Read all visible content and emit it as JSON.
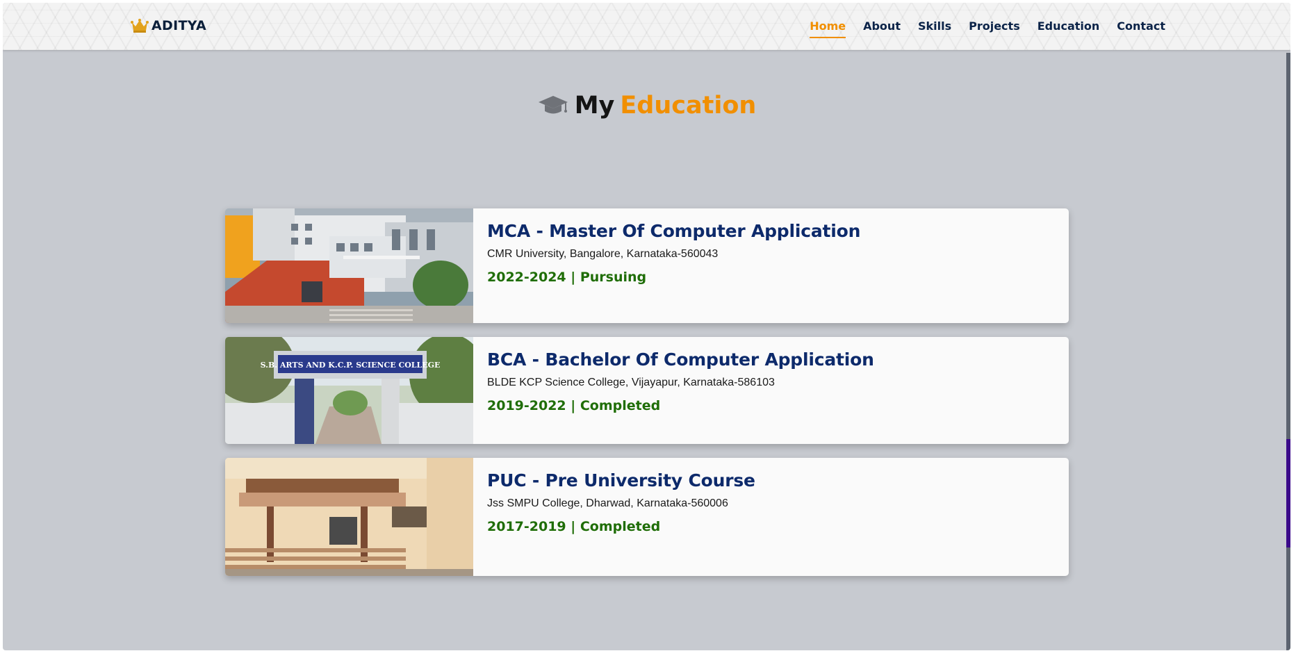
{
  "header": {
    "brand_name": "ADITYA",
    "brand_icon": "crown-icon",
    "nav": [
      {
        "label": "Home",
        "active": true
      },
      {
        "label": "About",
        "active": false
      },
      {
        "label": "Skills",
        "active": false
      },
      {
        "label": "Projects",
        "active": false
      },
      {
        "label": "Education",
        "active": false
      },
      {
        "label": "Contact",
        "active": false
      }
    ]
  },
  "section": {
    "icon": "graduation-cap-icon",
    "title_prefix": "My",
    "title_accent": "Education"
  },
  "education": [
    {
      "degree": "MCA - Master Of Computer Application",
      "institution": "CMR University, Bangalore, Karnataka-560043",
      "status": "2022-2024 | Pursuing",
      "photo": "cmr-university-building-photo"
    },
    {
      "degree": "BCA - Bachelor Of Computer Application",
      "institution": "BLDE KCP Science College, Vijayapur, Karnataka-586103",
      "status": "2019-2022 | Completed",
      "photo": "bca-college-gate-photo",
      "photo_sign_text": "S.B. ARTS AND K.C.P. SCIENCE COLLEGE"
    },
    {
      "degree": "PUC - Pre University Course",
      "institution": "Jss SMPU College, Dharwad, Karnataka-560006",
      "status": "2017-2019 | Completed",
      "photo": "puc-college-entrance-photo"
    }
  ],
  "colors": {
    "accent": "#f18f00",
    "heading_blue": "#0d2a6b",
    "status_green": "#1f6d07",
    "page_bg": "#c7cad0"
  }
}
